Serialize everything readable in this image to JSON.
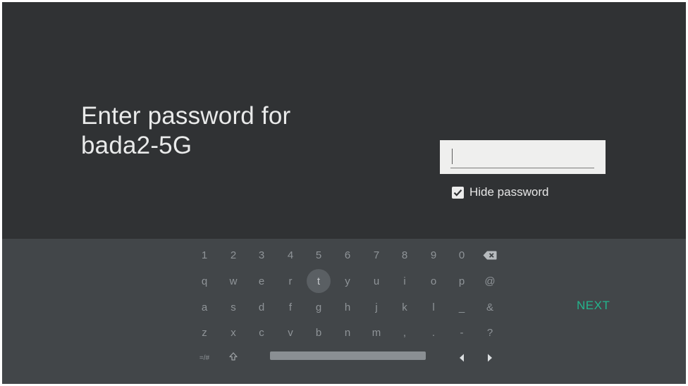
{
  "header": {
    "title_line1": "Enter password for",
    "title_line2": "bada2-5G"
  },
  "password_field": {
    "value": "",
    "placeholder": ""
  },
  "hide_password": {
    "label": "Hide password",
    "checked": true
  },
  "keyboard": {
    "row1": [
      "1",
      "2",
      "3",
      "4",
      "5",
      "6",
      "7",
      "8",
      "9",
      "0"
    ],
    "row2": [
      "q",
      "w",
      "e",
      "r",
      "t",
      "y",
      "u",
      "i",
      "o",
      "p",
      "@"
    ],
    "row3": [
      "a",
      "s",
      "d",
      "f",
      "g",
      "h",
      "j",
      "k",
      "l",
      "_",
      "&"
    ],
    "row4": [
      "z",
      "x",
      "c",
      "v",
      "b",
      "n",
      "m",
      ",",
      ".",
      "-",
      "?"
    ],
    "symbols_label": "=/#",
    "focused_key": "t",
    "next_label": "NEXT",
    "colors": {
      "accent": "#23b58d",
      "panel": "#424649",
      "background": "#303234"
    }
  }
}
